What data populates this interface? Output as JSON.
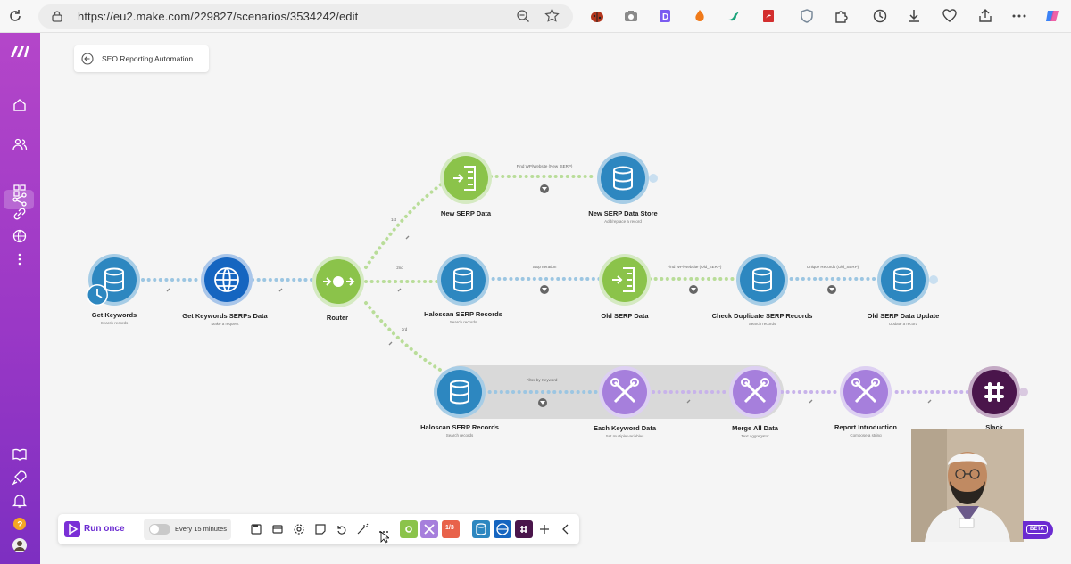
{
  "browser": {
    "url": "https://eu2.make.com/229827/scenarios/3534242/edit"
  },
  "scenario": {
    "title": "SEO Reporting Automation"
  },
  "nodes": {
    "get_keywords": {
      "label": "Get Keywords",
      "sub": "Search records"
    },
    "get_serps": {
      "label": "Get Keywords SERPs Data",
      "sub": "Make a request"
    },
    "router": {
      "label": "Router",
      "sub": ""
    },
    "new_serp": {
      "label": "New SERP Data",
      "sub": ""
    },
    "new_serp_store": {
      "label": "New SERP Data Store",
      "sub": "Add/replace a record"
    },
    "haloscan_1": {
      "label": "Haloscan SERP Records",
      "sub": "Search records"
    },
    "old_serp": {
      "label": "Old SERP Data",
      "sub": ""
    },
    "check_dup": {
      "label": "Check Duplicate SERP Records",
      "sub": "Search records"
    },
    "old_serp_update": {
      "label": "Old SERP Data Update",
      "sub": "Update a record"
    },
    "haloscan_2": {
      "label": "Haloscan SERP Records",
      "sub": "Search records"
    },
    "each_keyword": {
      "label": "Each Keyword Data",
      "sub": "Set multiple variables"
    },
    "merge_all": {
      "label": "Merge All Data",
      "sub": "Text aggregator"
    },
    "report_intro": {
      "label": "Report Introduction",
      "sub": "Compose a string"
    },
    "slack": {
      "label": "Slack",
      "sub": ""
    }
  },
  "routes": {
    "r1": "1st",
    "r2": "2nd",
    "r3": "3rd",
    "f_new": "Find WP/Website (New_SERP)",
    "f_stop": "Stop Iteration",
    "f_old": "Find WP/Website (Old_SERP)",
    "f_unique": "Unique Records (Old_SERP)",
    "f_filter": "Filter by Keyword"
  },
  "toolbar": {
    "run_label": "Run once",
    "schedule_label": "Every 15 minutes",
    "tools_badge": "1/3",
    "beta_label": "BETA"
  },
  "colors": {
    "sidebar": "#9a38c6",
    "datastore": "#2d87c0",
    "http": "#1565c0",
    "flow": "#8bc34a",
    "tools": "#a67fdc",
    "slack": "#4a154b",
    "accent": "#6b2bd1"
  }
}
